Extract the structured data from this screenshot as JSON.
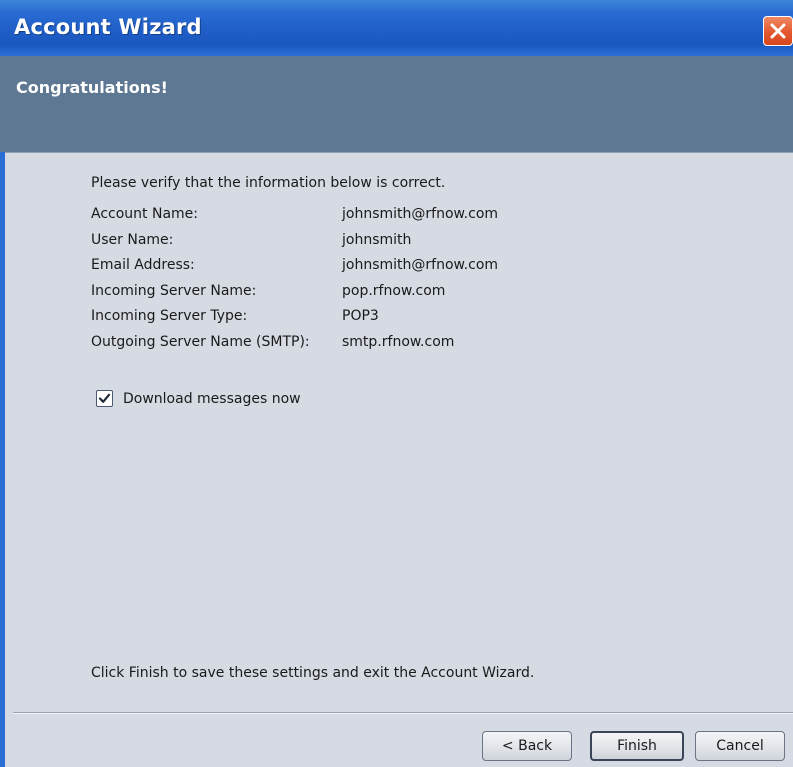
{
  "window": {
    "title": "Account Wizard"
  },
  "header": {
    "title": "Congratulations!"
  },
  "content": {
    "intro": "Please verify that the information below is correct.",
    "rows": [
      {
        "label": "Account Name:",
        "value": "johnsmith@rfnow.com"
      },
      {
        "label": "User Name:",
        "value": "johnsmith"
      },
      {
        "label": "Email Address:",
        "value": "johnsmith@rfnow.com"
      },
      {
        "label": "Incoming Server Name:",
        "value": "pop.rfnow.com"
      },
      {
        "label": "Incoming Server Type:",
        "value": "POP3"
      },
      {
        "label": "Outgoing Server Name (SMTP):",
        "value": "smtp.rfnow.com"
      }
    ],
    "download_checkbox": {
      "label": "Download messages now",
      "checked": true
    },
    "footer": "Click Finish to save these settings and exit the Account Wizard."
  },
  "buttons": {
    "back": "< Back",
    "finish": "Finish",
    "cancel": "Cancel"
  },
  "colors": {
    "titlebar": "#1f5ec6",
    "header_band": "#5e7894",
    "body": "#d5dae3",
    "close": "#e4572e"
  }
}
